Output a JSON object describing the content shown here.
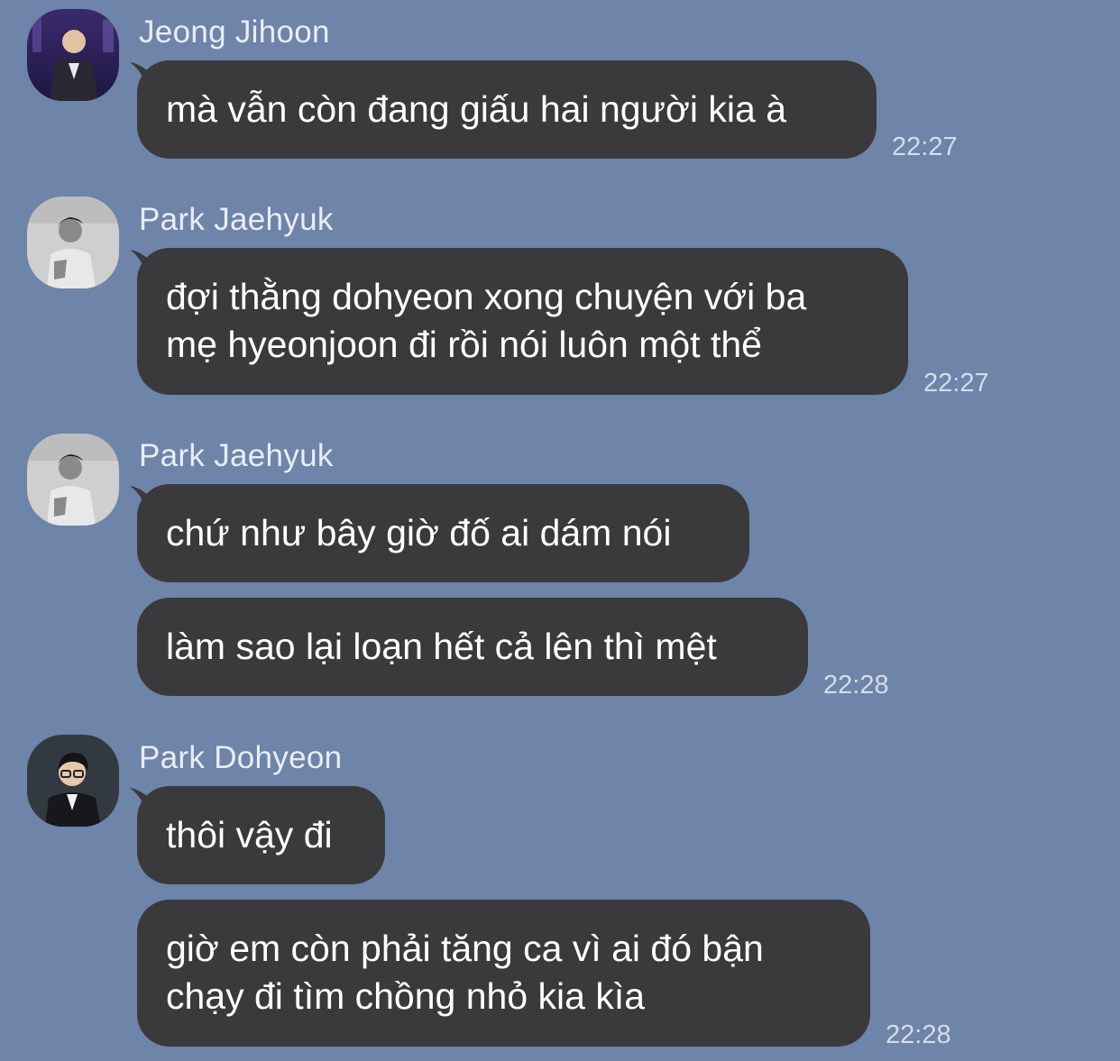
{
  "messages": [
    {
      "sender": "Jeong Jihoon",
      "avatar": "profile-photo-jeong-jihoon",
      "bubbles": [
        "mà vẫn còn đang giấu hai người kia à"
      ],
      "time": "22:27"
    },
    {
      "sender": "Park Jaehyuk",
      "avatar": "profile-photo-park-jaehyuk",
      "bubbles": [
        [
          "đợi thằng dohyeon xong chuyện với ba",
          "mẹ hyeonjoon đi rồi nói luôn một thể"
        ]
      ],
      "time": "22:27"
    },
    {
      "sender": "Park Jaehyuk",
      "avatar": "profile-photo-park-jaehyuk",
      "bubbles": [
        "chứ như bây giờ đố ai dám nói",
        "làm sao lại loạn hết cả lên thì mệt"
      ],
      "time": "22:28"
    },
    {
      "sender": "Park Dohyeon",
      "avatar": "profile-photo-park-dohyeon",
      "bubbles": [
        "thôi vậy đi",
        [
          "giờ em còn phải tăng ca vì ai đó bận",
          "chạy đi tìm chồng nhỏ kia kìa"
        ]
      ],
      "time": "22:28"
    }
  ],
  "colors": {
    "background": "#6E84A8",
    "bubble": "#3A3A3C",
    "bubble_text": "#FFFFFF",
    "sender_name": "#E8EDF5",
    "timestamp": "#D5DDEA"
  }
}
